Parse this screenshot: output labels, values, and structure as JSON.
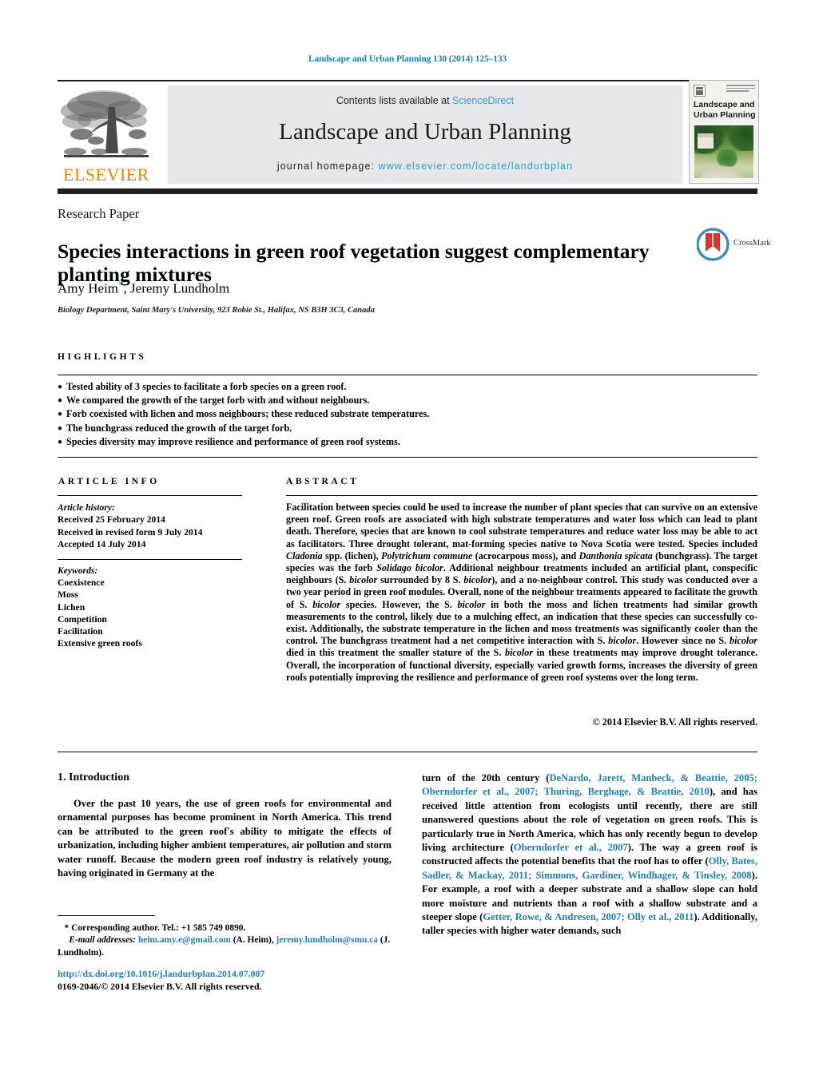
{
  "running_head": "Landscape and Urban Planning 130 (2014) 125–133",
  "masthead": {
    "contents_prefix": "Contents lists available at ",
    "sciencedirect": "ScienceDirect",
    "journal_name": "Landscape and Urban Planning",
    "homepage_prefix": "journal homepage: ",
    "homepage_url": "www.elsevier.com/locate/landurbplan",
    "publisher": "ELSEVIER",
    "cover_title": "Landscape and Urban Planning"
  },
  "article": {
    "doctype": "Research Paper",
    "title": "Species interactions in green roof vegetation suggest complementary planting mixtures",
    "authors": "Amy Heim",
    "authors_rest": ", Jeremy Lundholm",
    "corresponding_star": "*",
    "affiliation": "Biology Department, Saint Mary's University, 923 Robie St., Halifax, NS B3H 3C3, Canada",
    "crossmark_label": "CrossMark"
  },
  "highlights": {
    "heading": "HIGHLIGHTS",
    "items": [
      "Tested ability of 3 species to facilitate a forb species on a green roof.",
      "We compared the growth of the target forb with and without neighbours.",
      "Forb coexisted with lichen and moss neighbours; these reduced substrate temperatures.",
      "The bunchgrass reduced the growth of the target forb.",
      "Species diversity may improve resilience and performance of green roof systems."
    ]
  },
  "article_info": {
    "heading": "ARTICLE INFO",
    "history_label": "Article history:",
    "history": [
      "Received 25 February 2014",
      "Received in revised form 9 July 2014",
      "Accepted 14 July 2014"
    ],
    "keywords_label": "Keywords:",
    "keywords": [
      "Coexistence",
      "Moss",
      "Lichen",
      "Competition",
      "Facilitation",
      "Extensive green roofs"
    ]
  },
  "abstract": {
    "heading": "ABSTRACT",
    "paragraph_1": "Facilitation between species could be used to increase the number of plant species that can survive on an extensive green roof. Green roofs are associated with high substrate temperatures and water loss which can lead to plant death. Therefore, species that are known to cool substrate temperatures and reduce water loss may be able to act as facilitators. Three drought tolerant, mat-forming species native to Nova Scotia were tested. Species included ",
    "sp_1": "Cladonia",
    "paragraph_2": " spp. (lichen), ",
    "sp_2": "Polytrichum commune",
    "paragraph_3": " (acrocarpous moss), and ",
    "sp_3": "Danthonia spicata",
    "paragraph_4": " (bunchgrass). The target species was the forb ",
    "sp_4": "Solidago bicolor",
    "paragraph_5": ". Additional neighbour treatments included an artificial plant, conspecific neighbours (S. ",
    "sp_5": "bicolor",
    "paragraph_6": " surrounded by 8 S. ",
    "sp_6": "bicolor",
    "paragraph_7": "), and a no-neighbour control. This study was conducted over a two year period in green roof modules. Overall, none of the neighbour treatments appeared to facilitate the growth of S. ",
    "sp_7": "bicolor",
    "paragraph_8": " species. However, the S. ",
    "sp_8": "bicolor",
    "paragraph_9": " in both the moss and lichen treatments had similar growth measurements to the control, likely due to a mulching effect, an indication that these species can successfully co-exist. Additionally, the substrate temperature in the lichen and moss treatments was significantly cooler than the control. The bunchgrass treatment had a net competitive interaction with S. ",
    "sp_9": "bicolor",
    "paragraph_10": ". However since no S. ",
    "sp_10": "bicolor",
    "paragraph_11": " died in this treatment the smaller stature of the S. ",
    "sp_11": "bicolor",
    "paragraph_12": " in these treatments may improve drought tolerance. Overall, the incorporation of functional diversity, especially varied growth forms, increases the diversity of green roofs potentially improving the resilience and performance of green roof systems over the long term.",
    "copyright": "© 2014 Elsevier B.V. All rights reserved."
  },
  "body": {
    "section_number_title": "1. Introduction",
    "left_paragraph": "Over the past 10 years, the use of green roofs for environmental and ornamental purposes has become prominent in North America. This trend can be attributed to the green roof's ability to mitigate the effects of urbanization, including higher ambient temperatures, air pollution and storm water runoff. Because the modern green roof industry is relatively young, having originated in Germany at the",
    "right_t1": "turn of the 20th century (",
    "right_r1": "DeNardo, Jarett, Manbeck, & Beattie, 2005; Oberndorfer et al., 2007; Thuring, Berghage, & Beattie, 2010",
    "right_t2": "), and has received little attention from ecologists until recently, there are still unanswered questions about the role of vegetation on green roofs. This is particularly true in North America, which has only recently begun to develop living architecture (",
    "right_r2": "Oberndorfer et al., 2007",
    "right_t3": "). The way a green roof is constructed affects the potential benefits that the roof has to offer (",
    "right_r3": "Olly, Bates, Sadler, & Mackay, 2011; Simmons, Gardiner, Windhager, & Tinsley, 2008",
    "right_t4": "). For example, a roof with a deeper substrate and a shallow slope can hold more moisture and nutrients than a roof with a shallow substrate and a steeper slope (",
    "right_r4": "Getter, Rowe, & Andresen, 2007; Olly et al., 2011",
    "right_t5": "). Additionally, taller species with higher water demands, such"
  },
  "footnotes": {
    "star": "*",
    "corresponding": "Corresponding author. Tel.: +1 585 749 0890.",
    "email_label": "E-mail addresses:",
    "email_1": "heim.amy.e@gmail.com",
    "email_1_owner": " (A. Heim), ",
    "email_2": "jeremy.lundholm@smu.ca",
    "email_2_owner": " (J. Lundholm).",
    "doi": "http://dx.doi.org/10.1016/j.landurbplan.2014.07.007",
    "issn_line": "0169-2046/© 2014 Elsevier B.V. All rights reserved."
  },
  "colors": {
    "link_blue": "#1f7fb5",
    "sciencedirect_blue": "#2a9fd6",
    "elsevier_orange": "#ef8200",
    "banner_gray": "#e6e7e8"
  }
}
